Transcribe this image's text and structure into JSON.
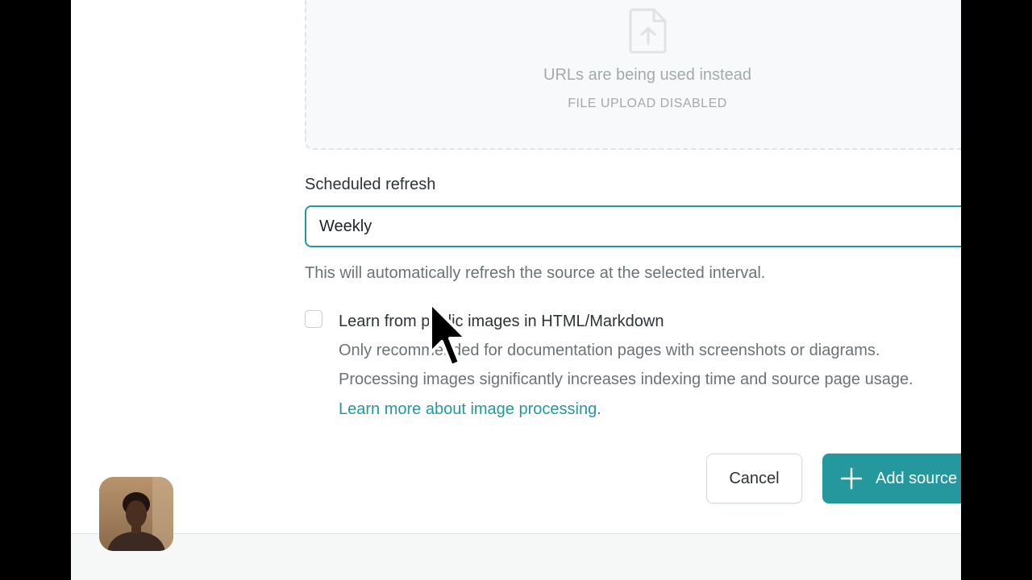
{
  "dropzone": {
    "icon": "file-upload-icon",
    "main_text": "URLs are being used instead",
    "sub_text": "FILE UPLOAD DISABLED"
  },
  "refresh": {
    "label": "Scheduled refresh",
    "value": "Weekly",
    "helper": "This will automatically refresh the source at the selected interval."
  },
  "images_option": {
    "checked": false,
    "label": "Learn from public images in HTML/Markdown",
    "desc_line1": "Only recommended for documentation pages with screenshots or diagrams.",
    "desc_line2": "Processing images significantly increases indexing time and source page usage.",
    "link_text": "Learn more about image processing",
    "link_suffix": "."
  },
  "actions": {
    "cancel_label": "Cancel",
    "add_label": "Add source",
    "add_icon": "plus-icon"
  },
  "colors": {
    "accent": "#24989c",
    "muted_text": "#6b7377",
    "placeholder_text": "#a3aaae"
  }
}
